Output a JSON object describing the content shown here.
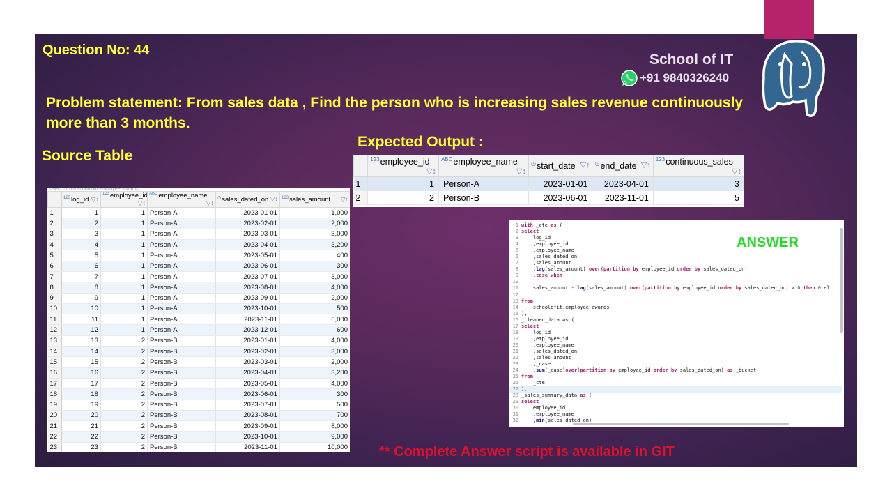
{
  "slide": {
    "question_no": "Question No: 44",
    "problem": "Problem statement:  From sales data , Find the person  who is increasing sales revenue continuously more than 3 months.",
    "source_title": "Source Table",
    "expected_title": "Expected  Output :",
    "brand": "School of IT",
    "phone": "+91 9840326240",
    "footer": "** Complete Answer script is available in GIT",
    "answer_label": "ANSWER",
    "accent_color": "#b5246a"
  },
  "source_table": {
    "query_text": "select * from schoolofit.employee_awards",
    "columns": [
      {
        "type": "123",
        "name": "log_id"
      },
      {
        "type": "123",
        "name": "employee_id"
      },
      {
        "type": "abc",
        "name": "employee_name"
      },
      {
        "type": "date",
        "name": "sales_dated_on"
      },
      {
        "type": "123",
        "name": "sales_amount"
      }
    ],
    "rows": [
      [
        "1",
        "1",
        "1",
        "Person-A",
        "2023-01-01",
        "1,000"
      ],
      [
        "2",
        "2",
        "1",
        "Person-A",
        "2023-02-01",
        "2,000"
      ],
      [
        "3",
        "3",
        "1",
        "Person-A",
        "2023-03-01",
        "3,000"
      ],
      [
        "4",
        "4",
        "1",
        "Person-A",
        "2023-04-01",
        "3,200"
      ],
      [
        "5",
        "5",
        "1",
        "Person-A",
        "2023-05-01",
        "400"
      ],
      [
        "6",
        "6",
        "1",
        "Person-A",
        "2023-06-01",
        "300"
      ],
      [
        "7",
        "7",
        "1",
        "Person-A",
        "2023-07-01",
        "3,000"
      ],
      [
        "8",
        "8",
        "1",
        "Person-A",
        "2023-08-01",
        "4,000"
      ],
      [
        "9",
        "9",
        "1",
        "Person-A",
        "2023-09-01",
        "2,000"
      ],
      [
        "10",
        "10",
        "1",
        "Person-A",
        "2023-10-01",
        "500"
      ],
      [
        "11",
        "11",
        "1",
        "Person-A",
        "2023-11-01",
        "6,000"
      ],
      [
        "12",
        "12",
        "1",
        "Person-A",
        "2023-12-01",
        "600"
      ],
      [
        "13",
        "13",
        "2",
        "Person-B",
        "2023-01-01",
        "4,000"
      ],
      [
        "14",
        "14",
        "2",
        "Person-B",
        "2023-02-01",
        "3,000"
      ],
      [
        "15",
        "15",
        "2",
        "Person-B",
        "2023-03-01",
        "2,000"
      ],
      [
        "16",
        "16",
        "2",
        "Person-B",
        "2023-04-01",
        "3,200"
      ],
      [
        "17",
        "17",
        "2",
        "Person-B",
        "2023-05-01",
        "4,000"
      ],
      [
        "18",
        "18",
        "2",
        "Person-B",
        "2023-06-01",
        "300"
      ],
      [
        "19",
        "19",
        "2",
        "Person-B",
        "2023-07-01",
        "500"
      ],
      [
        "20",
        "20",
        "2",
        "Person-B",
        "2023-08-01",
        "700"
      ],
      [
        "21",
        "21",
        "2",
        "Person-B",
        "2023-09-01",
        "8,000"
      ],
      [
        "22",
        "22",
        "2",
        "Person-B",
        "2023-10-01",
        "9,000"
      ],
      [
        "23",
        "23",
        "2",
        "Person-B",
        "2023-11-01",
        "10,000"
      ]
    ]
  },
  "expected_output": {
    "columns": [
      {
        "type": "123",
        "name": "employee_id"
      },
      {
        "type": "abc",
        "name": "employee_name"
      },
      {
        "type": "date",
        "name": "start_date"
      },
      {
        "type": "date",
        "name": "end_date"
      },
      {
        "type": "123",
        "name": "continuous_sales"
      }
    ],
    "rows": [
      [
        "1",
        "1",
        "Person-A",
        "2023-01-01",
        "2023-04-01",
        "3"
      ],
      [
        "2",
        "2",
        "Person-B",
        "2023-06-01",
        "2023-11-01",
        "5"
      ]
    ]
  },
  "code": {
    "lines": [
      {
        "n": "1",
        "t": "with _cte as ("
      },
      {
        "n": "2",
        "t": "select"
      },
      {
        "n": "3",
        "t": "    log_id"
      },
      {
        "n": "4",
        "t": "    ,employee_id"
      },
      {
        "n": "5",
        "t": "    ,employee_name"
      },
      {
        "n": "6",
        "t": "    ,sales_dated_on"
      },
      {
        "n": "7",
        "t": "    ,sales_amount"
      },
      {
        "n": "8",
        "t": "    ,lag(sales_amount) over(partition by employee_id order by sales_dated_on)"
      },
      {
        "n": "9",
        "t": "    ,case when"
      },
      {
        "n": "10",
        "t": ""
      },
      {
        "n": "11",
        "t": "    sales_amount - lag(sales_amount) over(partition by employee_id order by sales_dated_on) > 0 then 0 el"
      },
      {
        "n": "12",
        "t": ""
      },
      {
        "n": "13",
        "t": "from"
      },
      {
        "n": "14",
        "t": "    schoolofit.employee_awards"
      },
      {
        "n": "15",
        "t": "),"
      },
      {
        "n": "16",
        "t": "_cleaned_data as ("
      },
      {
        "n": "17",
        "t": "select"
      },
      {
        "n": "18",
        "t": "    log_id"
      },
      {
        "n": "19",
        "t": "    ,employee_id"
      },
      {
        "n": "20",
        "t": "    ,employee_name"
      },
      {
        "n": "21",
        "t": "    ,sales_dated_on"
      },
      {
        "n": "22",
        "t": "    ,sales_amount"
      },
      {
        "n": "23",
        "t": "    ,_case"
      },
      {
        "n": "24",
        "t": "    ,sum(_case)over(partition by employee_id order by sales_dated_on) as _bucket"
      },
      {
        "n": "25",
        "t": "from"
      },
      {
        "n": "26",
        "t": "    _cte"
      },
      {
        "n": "27",
        "t": "),"
      },
      {
        "n": "28",
        "t": "_sales_summary_data as ("
      },
      {
        "n": "29",
        "t": "select"
      },
      {
        "n": "30",
        "t": "    employee_id"
      },
      {
        "n": "31",
        "t": "    ,employee_name"
      },
      {
        "n": "32",
        "t": "    ,min(sales_dated_on)"
      }
    ]
  }
}
